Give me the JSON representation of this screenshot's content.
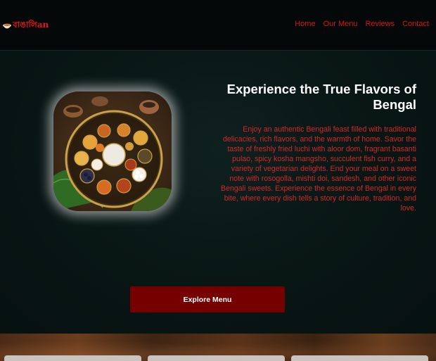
{
  "brand": {
    "logo_text": "বাঙালিan",
    "accent_color": "#d5151a"
  },
  "nav": {
    "items": [
      {
        "label": "Home"
      },
      {
        "label": "Our Menu"
      },
      {
        "label": "Reviews"
      },
      {
        "label": "Contact"
      }
    ]
  },
  "hero": {
    "title": "Experience the True Flavors of Bengal",
    "description": "Enjoy an authentic Bengali feast filled with traditional delicacies, rich flavors, and the warmth of home. Savor the taste of freshly fried luchi with aloor dom, fragrant basanti pulao, spicy kosha mangsho, succulent fish curry, and a variety of vegetarian delights. End your meal on a sweet note with rosogolla, mishti doi, sandesh, and other iconic Bengali sweets. Experience the essence of Bengal in every bite, where every dish tells a story of culture, tradition, and love.",
    "button_label": "Explore Menu",
    "button_color": "#760000",
    "image_icon": "bengali-thali-image"
  },
  "colors": {
    "header_bg": "#050808",
    "hero_bg": "#091715",
    "title_color": "#ffffff",
    "text_color": "#d8262a"
  }
}
